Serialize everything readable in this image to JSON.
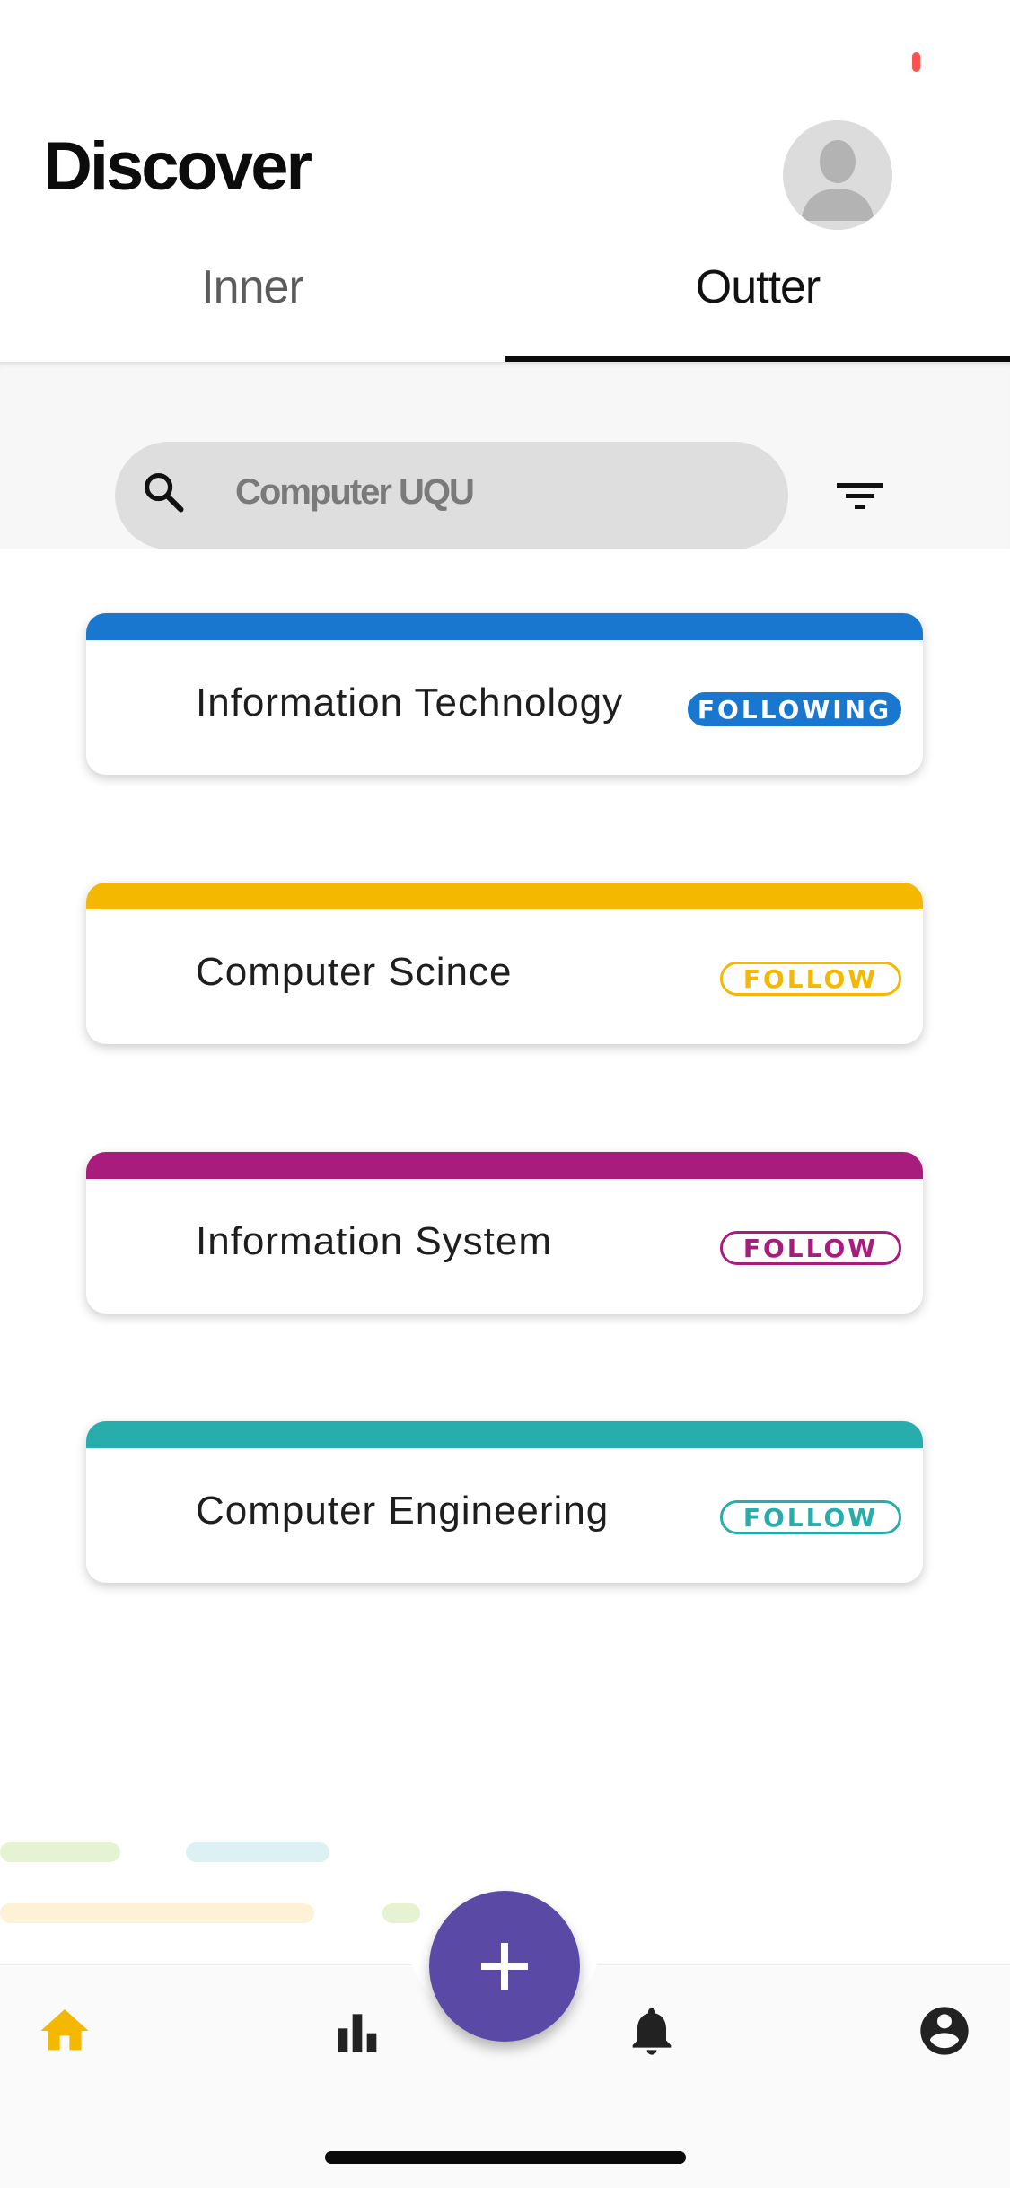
{
  "header": {
    "title": "Discover"
  },
  "tabs": [
    {
      "label": "Inner",
      "active": false
    },
    {
      "label": "Outter",
      "active": true
    }
  ],
  "search": {
    "value": "Computer UQU"
  },
  "departments": [
    {
      "name": "Information Technology",
      "button": "FOLLOWING",
      "following": true,
      "color": "#1a77cf"
    },
    {
      "name": "Computer Scince",
      "button": "FOLLOW",
      "following": false,
      "color": "#f5b800"
    },
    {
      "name": "Information System",
      "button": "FOLLOW",
      "following": false,
      "color": "#a81c7e"
    },
    {
      "name": "Computer Engineering",
      "button": "FOLLOW",
      "following": false,
      "color": "#27adac"
    }
  ],
  "bottom_nav": {
    "items": [
      {
        "icon": "home-icon",
        "active": true
      },
      {
        "icon": "bar-chart-icon",
        "active": false
      },
      {
        "icon": "bell-icon",
        "active": false
      },
      {
        "icon": "account-circle-icon",
        "active": false
      }
    ],
    "fab_icon": "plus-icon"
  },
  "colors": {
    "accent": "#5a4aa6",
    "active_nav": "#f5b800",
    "status_dot": "#ff4f4f"
  }
}
